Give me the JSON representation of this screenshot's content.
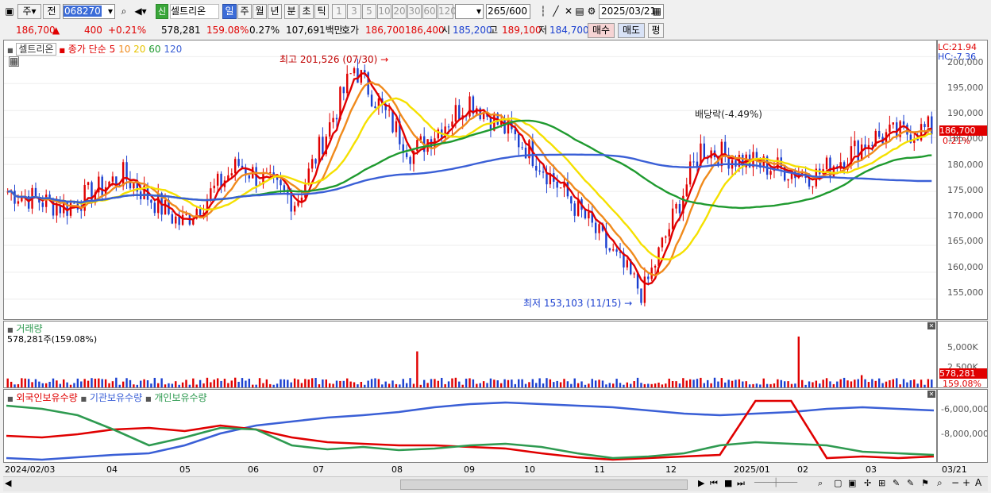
{
  "toolbar": {
    "period_code": "주",
    "prev_label": "전",
    "code": "068270",
    "stock_name": "셀트리온",
    "new_badge": "신",
    "period_tabs": [
      "일",
      "주",
      "월",
      "년",
      "분",
      "초",
      "틱"
    ],
    "active_tab": "일",
    "intervals": [
      "1",
      "3",
      "5",
      "10",
      "20",
      "30",
      "60",
      "120"
    ],
    "count": "265",
    "count_total": "/600",
    "date": "2025/03/21"
  },
  "quote": {
    "price": "186,700",
    "change": "400",
    "change_pct": "+0.21%",
    "volume": "578,281",
    "volume_ratio": "159.08%",
    "turnover": "0.27%",
    "amount": "107,691백만",
    "hoga_label": "호가",
    "ask": "186,700",
    "bid": "186,400",
    "open_label": "시",
    "open": "185,200",
    "high_label": "고",
    "high": "189,100",
    "low_label": "저",
    "low": "184,700",
    "buy_label": "매수",
    "sell_label": "매도",
    "eval_label": "평"
  },
  "price_panel": {
    "name_label": "셀트리온",
    "ma_label": "종가 단순",
    "ma_periods": [
      "5",
      "10",
      "20",
      "60",
      "120"
    ],
    "lc": "LC:21.94",
    "hc": "HC:-7.36",
    "y_ticks": [
      "200,000",
      "195,000",
      "190,000",
      "185,000",
      "180,000",
      "175,000",
      "170,000",
      "165,000",
      "160,000",
      "155,000"
    ],
    "high_note": "최고 201,526 (07/30)",
    "low_note": "최저 153,103 (11/15)",
    "dividend_note": "배당락(-4.49%)",
    "current_price_tag": "186,700",
    "current_pct_tag": "0.21%"
  },
  "volume_panel": {
    "title": "거래량",
    "value": "578,281주(159.08%)",
    "y_ticks": [
      "5,000K",
      "2,500K"
    ],
    "tag_value": "578,281",
    "tag_pct": "159.08%"
  },
  "holding_panel": {
    "legend": [
      "외국인보유수량",
      "기관보유수량",
      "개인보유수량"
    ],
    "y_ticks": [
      "-6,000,000",
      "-8,000,000"
    ]
  },
  "x_axis": {
    "labels": [
      "2024/02/03",
      "04",
      "05",
      "06",
      "07",
      "08",
      "09",
      "10",
      "11",
      "12",
      "2025/01",
      "02",
      "03"
    ],
    "end_label": "03/21"
  },
  "colors": {
    "up": "#e00000",
    "down": "#1a3fd0",
    "ma5": "#e00000",
    "ma10": "#f08a1c",
    "ma20": "#f5e000",
    "ma60": "#1f9a2f",
    "ma120": "#3a5fd6",
    "foreign": "#3a5fd6",
    "institution": "#e00000",
    "individual": "#2e9a50"
  },
  "chart_data": {
    "type": "candlestick",
    "title": "셀트리온",
    "ylim": [
      151000,
      203000
    ],
    "highlights": {
      "max": 201526,
      "max_date": "07/30",
      "min": 153103,
      "min_date": "11/15"
    },
    "anchors_date": [
      "2024/02",
      "2024/03",
      "2024/04",
      "2024/05",
      "2024/06",
      "2024/07",
      "2024/07/30",
      "2024/08",
      "2024/09",
      "2024/10",
      "2024/11",
      "2024/11/15",
      "2024/12",
      "2025/01",
      "2025/02",
      "2025/03",
      "2025/03/21"
    ],
    "anchors_close": [
      175000,
      172000,
      178000,
      169000,
      180000,
      173000,
      198000,
      182000,
      192000,
      183000,
      170000,
      156000,
      183000,
      180000,
      178000,
      185000,
      186700
    ]
  }
}
